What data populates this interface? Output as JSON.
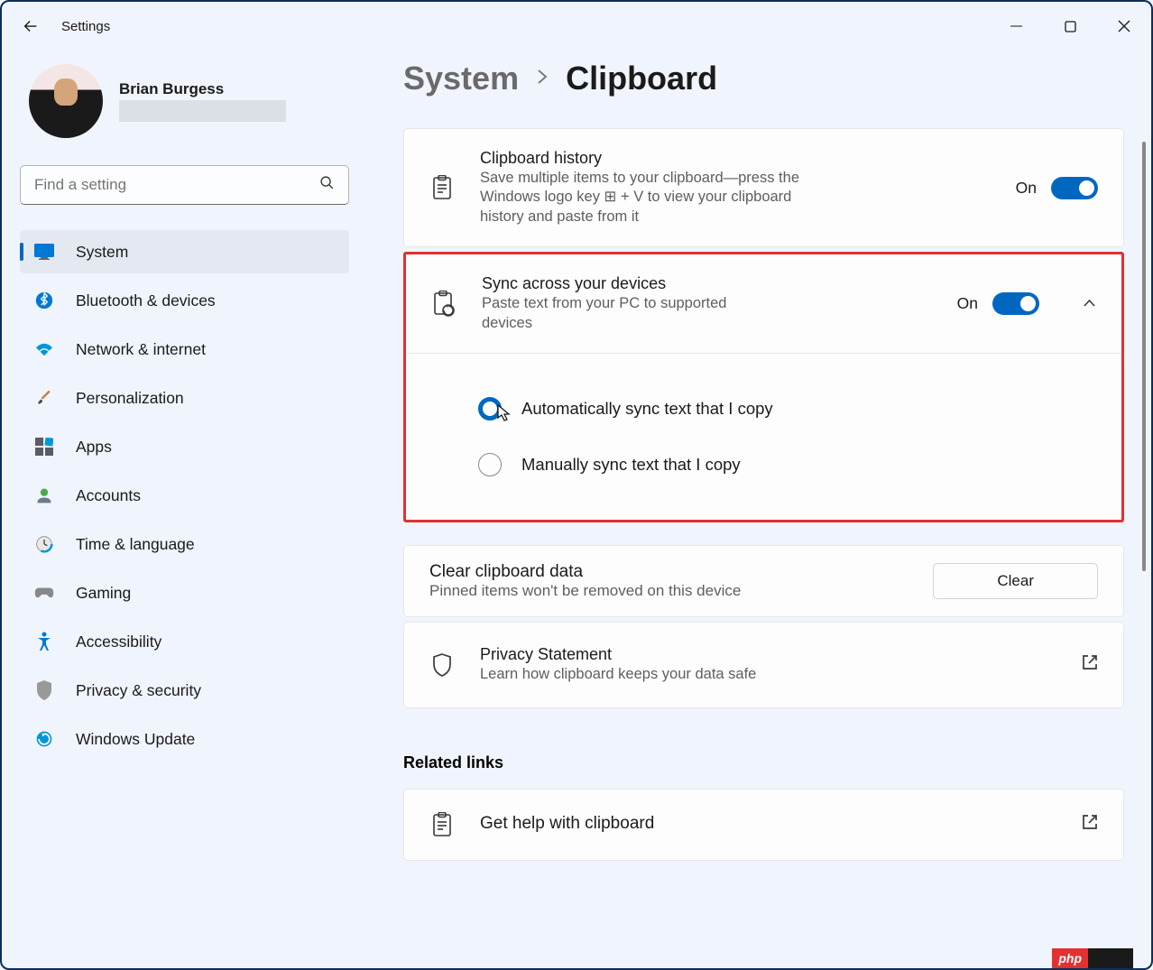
{
  "app": {
    "title": "Settings"
  },
  "user": {
    "name": "Brian Burgess"
  },
  "search": {
    "placeholder": "Find a setting"
  },
  "sidebar": {
    "items": [
      {
        "label": "System",
        "active": true
      },
      {
        "label": "Bluetooth & devices",
        "active": false
      },
      {
        "label": "Network & internet",
        "active": false
      },
      {
        "label": "Personalization",
        "active": false
      },
      {
        "label": "Apps",
        "active": false
      },
      {
        "label": "Accounts",
        "active": false
      },
      {
        "label": "Time & language",
        "active": false
      },
      {
        "label": "Gaming",
        "active": false
      },
      {
        "label": "Accessibility",
        "active": false
      },
      {
        "label": "Privacy & security",
        "active": false
      },
      {
        "label": "Windows Update",
        "active": false
      }
    ]
  },
  "breadcrumb": {
    "parent": "System",
    "current": "Clipboard"
  },
  "settings": {
    "clipboardHistory": {
      "title": "Clipboard history",
      "desc": "Save multiple items to your clipboard—press the Windows logo key ⊞ + V to view your clipboard history and paste from it",
      "toggleLabel": "On"
    },
    "syncDevices": {
      "title": "Sync across your devices",
      "desc": "Paste text from your PC to supported devices",
      "toggleLabel": "On",
      "options": {
        "auto": "Automatically sync text that I copy",
        "manual": "Manually sync text that I copy"
      }
    },
    "clearData": {
      "title": "Clear clipboard data",
      "desc": "Pinned items won't be removed on this device",
      "button": "Clear"
    },
    "privacy": {
      "title": "Privacy Statement",
      "desc": "Learn how clipboard keeps your data safe"
    }
  },
  "related": {
    "heading": "Related links",
    "helpLabel": "Get help with clipboard"
  },
  "badge": {
    "php": "php"
  }
}
